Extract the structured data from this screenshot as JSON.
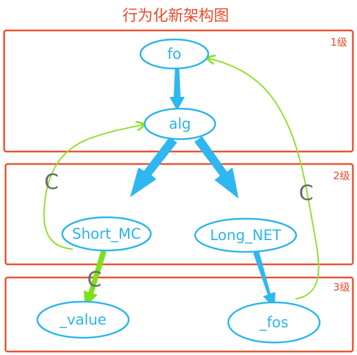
{
  "title": "行为化新架构图",
  "levels": [
    {
      "label": "1级"
    },
    {
      "label": "2级"
    },
    {
      "label": "3级"
    }
  ],
  "nodes": {
    "fo": "fo",
    "alg": "alg",
    "short_mc": "Short_MC",
    "long_net": "Long_NET",
    "value": "_value",
    "fos": "_fos"
  },
  "connector_labels": {
    "left": "C",
    "right": "C",
    "bottom": "C"
  },
  "colors": {
    "frame": "#e8502c",
    "title": "#e84a2a",
    "node": "#2bb5ea",
    "arrow": "#2fb7f0",
    "green_arrow": "#7ee01a",
    "green_curve": "#8ee02a",
    "c_label": "#6b6b6b"
  }
}
